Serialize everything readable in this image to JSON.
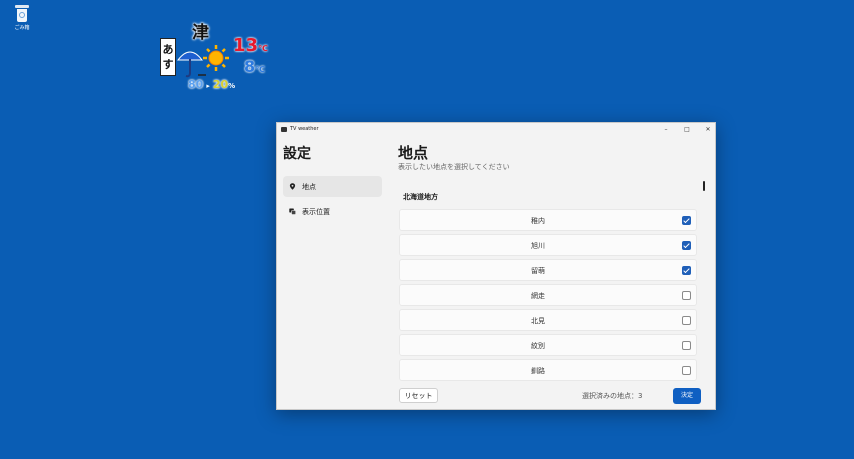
{
  "desktop": {
    "recycle_bin_label": "ごみ箱"
  },
  "weather": {
    "city": "津",
    "day_label": "あす",
    "icon": "umbrella-then-sun-icon",
    "high": "13",
    "low": "8",
    "temp_unit": "℃",
    "precip_1": "80",
    "precip_sep": "▸",
    "precip_2": "20",
    "precip_unit": "%"
  },
  "window": {
    "title": "TV weather",
    "minimize": "–",
    "maximize": "□",
    "close": "✕"
  },
  "sidebar": {
    "title": "設定",
    "items": [
      {
        "label": "地点",
        "icon": "location-pin-icon",
        "active": true
      },
      {
        "label": "表示位置",
        "icon": "display-position-icon",
        "active": false
      }
    ]
  },
  "main": {
    "title": "地点",
    "subtitle": "表示したい地点を選択してください",
    "region": "北海道地方",
    "locations": [
      {
        "name": "稚内",
        "checked": true
      },
      {
        "name": "旭川",
        "checked": true
      },
      {
        "name": "留萌",
        "checked": true
      },
      {
        "name": "網走",
        "checked": false
      },
      {
        "name": "北見",
        "checked": false
      },
      {
        "name": "紋別",
        "checked": false
      },
      {
        "name": "釧路",
        "checked": false
      }
    ]
  },
  "footer": {
    "reset_label": "リセット",
    "selected_count": "選択済みの地点：3",
    "ok_label": "決定"
  },
  "colors": {
    "desktop": "#0a5db4",
    "accent": "#1f5fb8",
    "high_temp": "#e8192c",
    "low_temp": "#2f7ce0"
  }
}
